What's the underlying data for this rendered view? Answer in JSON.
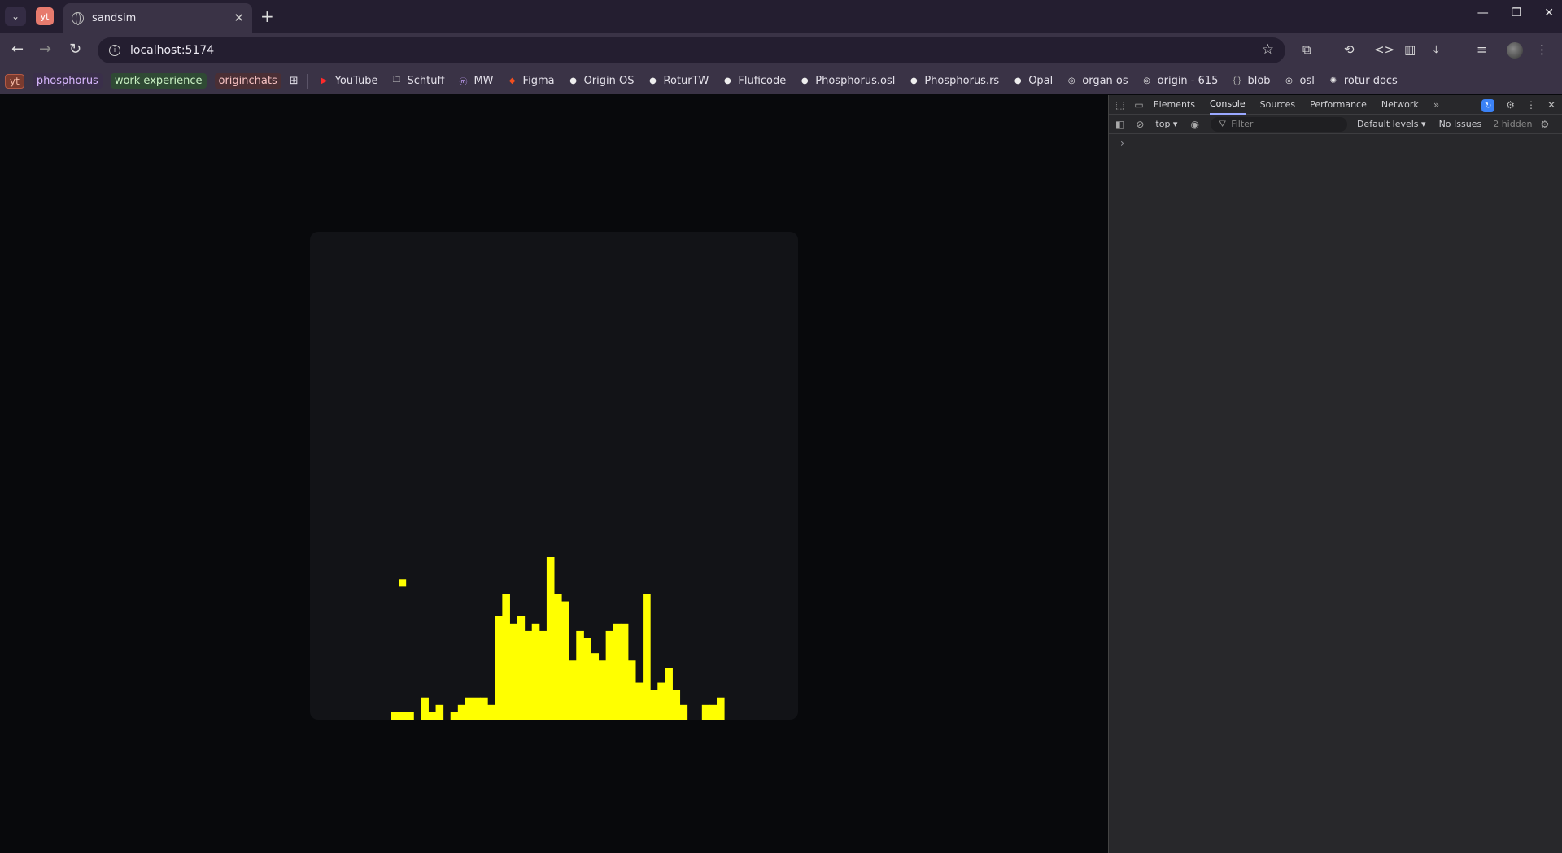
{
  "browser": {
    "pinned_tab_label": "yt",
    "active_tab_title": "sandsim",
    "address": "localhost:5174"
  },
  "bookmarks": [
    {
      "label": "yt",
      "kind": "chip-yt"
    },
    {
      "label": "phosphorus",
      "kind": "chip",
      "color": "#d9b8ff",
      "bg": "#3a2f4a"
    },
    {
      "label": "work experience",
      "kind": "chip",
      "color": "#c9f0c2",
      "bg": "#2f4a34"
    },
    {
      "label": "originchats",
      "kind": "chip",
      "color": "#f4c0c0",
      "bg": "#4a2f35"
    },
    {
      "label": "",
      "kind": "apps"
    },
    {
      "label": "YouTube",
      "kind": "link",
      "icon": "youtube-icon",
      "iconColor": "#ff2a2a"
    },
    {
      "label": "Schtuff",
      "kind": "link",
      "icon": "folder-icon",
      "iconColor": "#ccc"
    },
    {
      "label": "MW",
      "kind": "link",
      "icon": "mw-icon",
      "iconColor": "#c9a4ff"
    },
    {
      "label": "Figma",
      "kind": "link",
      "icon": "figma-icon",
      "iconColor": "#f24e1e"
    },
    {
      "label": "Origin OS",
      "kind": "link",
      "icon": "github-icon",
      "iconColor": "#eee"
    },
    {
      "label": "RoturTW",
      "kind": "link",
      "icon": "github-icon",
      "iconColor": "#eee"
    },
    {
      "label": "Fluficode",
      "kind": "link",
      "icon": "github-icon",
      "iconColor": "#eee"
    },
    {
      "label": "Phosphorus.osl",
      "kind": "link",
      "icon": "github-icon",
      "iconColor": "#eee"
    },
    {
      "label": "Phosphorus.rs",
      "kind": "link",
      "icon": "github-icon",
      "iconColor": "#eee"
    },
    {
      "label": "Opal",
      "kind": "link",
      "icon": "github-icon",
      "iconColor": "#eee"
    },
    {
      "label": "organ os",
      "kind": "link",
      "icon": "origin-icon",
      "iconColor": "#eee"
    },
    {
      "label": "origin - 615",
      "kind": "link",
      "icon": "origin-icon",
      "iconColor": "#eee"
    },
    {
      "label": "blob",
      "kind": "link",
      "icon": "braces-icon",
      "iconColor": "#aaa"
    },
    {
      "label": "osl",
      "kind": "link",
      "icon": "origin-icon",
      "iconColor": "#eee"
    },
    {
      "label": "rotur docs",
      "kind": "link",
      "icon": "rotur-icon",
      "iconColor": "#eee"
    }
  ],
  "sand": {
    "color": "#ffff00",
    "grid_cols": 66,
    "grid_rows": 66,
    "column_heights": [
      0,
      0,
      0,
      0,
      0,
      0,
      0,
      0,
      0,
      0,
      0,
      1,
      1,
      1,
      0,
      3,
      1,
      2,
      0,
      1,
      2,
      3,
      3,
      3,
      2,
      14,
      17,
      13,
      14,
      12,
      13,
      12,
      22,
      17,
      16,
      8,
      12,
      11,
      9,
      8,
      12,
      13,
      13,
      8,
      5,
      17,
      4,
      5,
      7,
      4,
      2,
      0,
      0,
      2,
      2,
      3,
      0,
      0,
      0,
      0,
      0,
      0,
      0,
      0,
      0,
      0
    ],
    "loose_grains": [
      [
        12,
        18
      ]
    ]
  },
  "devtools": {
    "tabs": [
      "Elements",
      "Console",
      "Sources",
      "Performance",
      "Network"
    ],
    "active_tab": "Console",
    "context": "top",
    "filter_placeholder": "Filter",
    "levels": "Default levels",
    "issues": "No Issues",
    "hidden": "2 hidden",
    "prompt": "›"
  }
}
